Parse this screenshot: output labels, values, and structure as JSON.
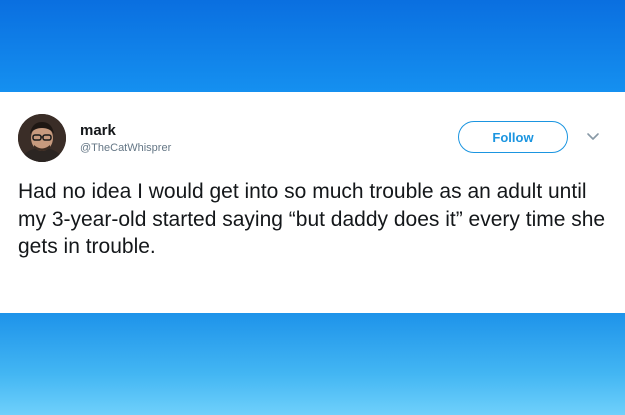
{
  "tweet": {
    "user": {
      "name": "mark",
      "handle": "@TheCatWhisprer"
    },
    "follow_label": "Follow",
    "text": "Had no idea I would get into so much trouble as an adult until my 3-year-old started saying “but daddy does it” every time she gets in trouble."
  },
  "colors": {
    "accent": "#1b95e0",
    "background_top": "#0a6fe0",
    "background_bottom": "#43b6f3"
  },
  "icons": {
    "menu": "chevron-down-icon"
  }
}
